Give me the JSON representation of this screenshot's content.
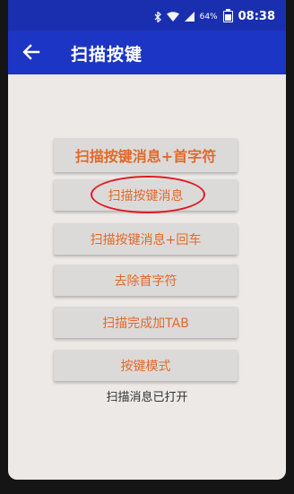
{
  "status_bar": {
    "battery": "64%",
    "time": "08:38"
  },
  "app_bar": {
    "title": "扫描按键"
  },
  "buttons": [
    {
      "label": "扫描按键消息+首字符"
    },
    {
      "label": "扫描按键消息"
    },
    {
      "label": "扫描按键消息+回车"
    },
    {
      "label": "去除首字符"
    },
    {
      "label": "扫描完成加TAB"
    },
    {
      "label": "按键模式"
    }
  ],
  "status_message": "扫描消息已打开",
  "colors": {
    "app_bar": "#1c35c4",
    "button_text": "#e06a2b",
    "annotation": "#e01b24"
  }
}
